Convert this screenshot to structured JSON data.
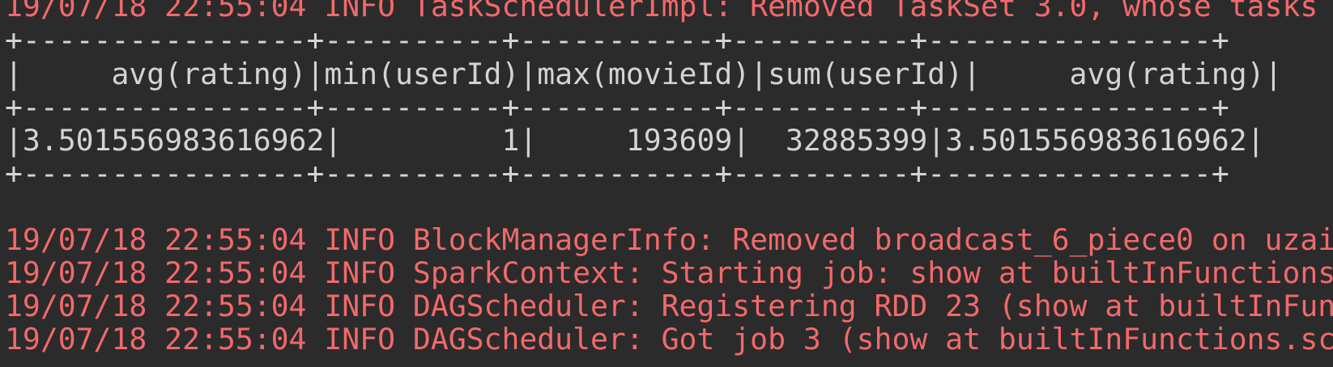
{
  "log_top": "19/07/18 22:55:04 INFO TaskSchedulerImpl: Removed TaskSet 3.0, whose tasks",
  "table": {
    "border_top": "+----------------+----------+-----------+----------+----------------+",
    "header": "|     avg(rating)|min(userId)|max(movieId)|sum(userId)|     avg(rating)|",
    "border_mid": "+----------------+----------+-----------+----------+----------------+",
    "row": "|3.501556983616962|         1|     193609|  32885399|3.501556983616962|",
    "border_bottom": "+----------------+----------+-----------+----------+----------------+"
  },
  "log_lines": [
    "19/07/18 22:55:04 INFO BlockManagerInfo: Removed broadcast_6_piece0 on uzai",
    "19/07/18 22:55:04 INFO SparkContext: Starting job: show at builtInFunctions",
    "19/07/18 22:55:04 INFO DAGScheduler: Registering RDD 23 (show at builtInFun",
    "19/07/18 22:55:04 INFO DAGScheduler: Got job 3 (show at builtInFunctions.sc"
  ],
  "colors": {
    "background": "#2b2b2b",
    "log_text": "#f2696b",
    "table_text": "#d4d4d4"
  }
}
